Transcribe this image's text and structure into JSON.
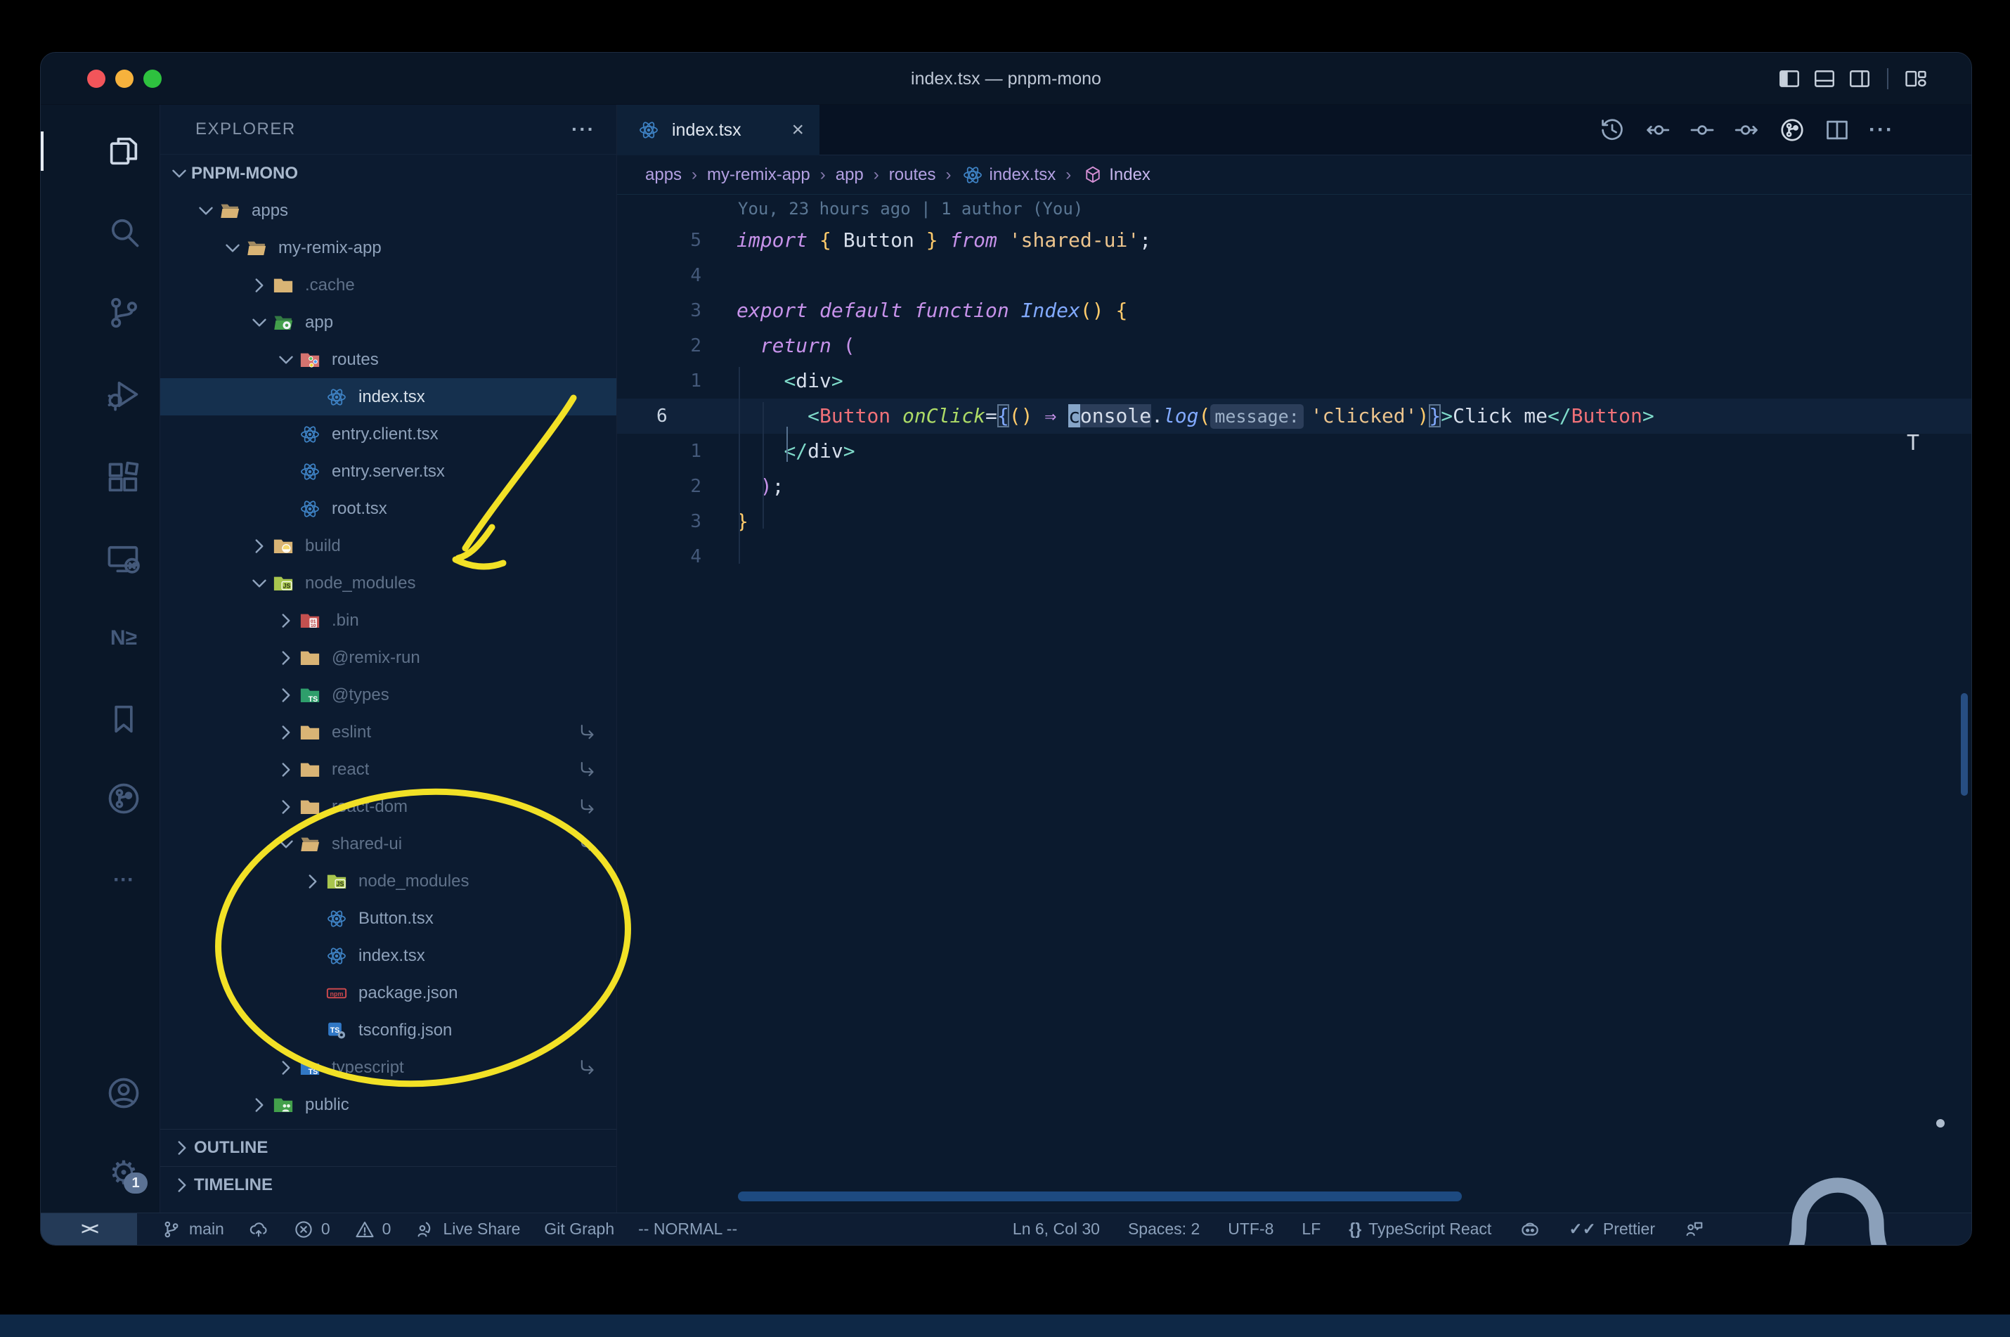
{
  "window": {
    "title": "index.tsx — pnpm-mono",
    "traffic_lights": [
      {
        "name": "close",
        "color": "#f2555a"
      },
      {
        "name": "minimize",
        "color": "#f6b23d"
      },
      {
        "name": "zoom",
        "color": "#2ec13f"
      }
    ],
    "layout_icons": [
      "toggle-sidebar",
      "toggle-panel",
      "toggle-secondary-sidebar",
      "customize-layout"
    ]
  },
  "activity_bar": {
    "items": [
      {
        "name": "explorer",
        "icon": "files",
        "active": true
      },
      {
        "name": "search",
        "icon": "search"
      },
      {
        "name": "source-control",
        "icon": "branch-big"
      },
      {
        "name": "run-debug",
        "icon": "debug"
      },
      {
        "name": "extensions",
        "icon": "extensions"
      },
      {
        "name": "remote-explorer",
        "icon": "remote-win"
      },
      {
        "name": "nx-console",
        "icon": "nx",
        "text": "N≥"
      },
      {
        "name": "bookmarks",
        "icon": "bookmark"
      },
      {
        "name": "git-graph",
        "icon": "git-circle"
      },
      {
        "name": "more-views",
        "icon": "dots",
        "text": "···"
      },
      {
        "name": "account",
        "icon": "account"
      },
      {
        "name": "settings",
        "icon": "gear",
        "text": "⚙",
        "badge": "1"
      }
    ]
  },
  "sidebar": {
    "header": {
      "title": "EXPLORER",
      "more_label": "···"
    },
    "tree": [
      {
        "label": "PNPM-MONO",
        "level": 0,
        "chev": "down",
        "bold": true
      },
      {
        "label": "apps",
        "icon": "folder-open",
        "level": 1,
        "chev": "down"
      },
      {
        "label": "my-remix-app",
        "icon": "folder-open",
        "level": 2,
        "chev": "down"
      },
      {
        "label": ".cache",
        "icon": "folder",
        "level": 3,
        "chev": "right",
        "dim": true
      },
      {
        "label": "app",
        "icon": "folder-app",
        "level": 3,
        "chev": "down"
      },
      {
        "label": "routes",
        "icon": "folder-routes",
        "level": 4,
        "chev": "down"
      },
      {
        "label": "index.tsx",
        "icon": "react",
        "level": 5,
        "selected": true
      },
      {
        "label": "entry.client.tsx",
        "icon": "react",
        "level": 4
      },
      {
        "label": "entry.server.tsx",
        "icon": "react",
        "level": 4
      },
      {
        "label": "root.tsx",
        "icon": "react",
        "level": 4
      },
      {
        "label": "build",
        "icon": "folder-build",
        "level": 3,
        "chev": "right",
        "dim": true
      },
      {
        "label": "node_modules",
        "icon": "folder-nm",
        "level": 3,
        "chev": "down",
        "dim": true
      },
      {
        "label": ".bin",
        "icon": "folder-bin",
        "level": 4,
        "chev": "right",
        "dim": true
      },
      {
        "label": "@remix-run",
        "icon": "folder",
        "level": 4,
        "chev": "right",
        "dim": true
      },
      {
        "label": "@types",
        "icon": "folder-ts-green",
        "level": 4,
        "chev": "right",
        "dim": true
      },
      {
        "label": "eslint",
        "icon": "folder",
        "level": 4,
        "chev": "right",
        "dim": true,
        "link": true
      },
      {
        "label": "react",
        "icon": "folder",
        "level": 4,
        "chev": "right",
        "dim": true,
        "link": true
      },
      {
        "label": "react-dom",
        "icon": "folder",
        "level": 4,
        "chev": "right",
        "dim": true,
        "link": true
      },
      {
        "label": "shared-ui",
        "icon": "folder-open",
        "level": 4,
        "chev": "down",
        "dim": true,
        "link": true
      },
      {
        "label": "node_modules",
        "icon": "folder-nm",
        "level": 5,
        "chev": "right",
        "dim": true
      },
      {
        "label": "Button.tsx",
        "icon": "react",
        "level": 5
      },
      {
        "label": "index.tsx",
        "icon": "react",
        "level": 5
      },
      {
        "label": "package.json",
        "icon": "npm",
        "level": 5
      },
      {
        "label": "tsconfig.json",
        "icon": "ts-config",
        "level": 5
      },
      {
        "label": "typescript",
        "icon": "folder-ts-blue",
        "level": 4,
        "chev": "right",
        "dim": true,
        "link": true
      },
      {
        "label": "public",
        "icon": "folder-public",
        "level": 3,
        "chev": "right"
      }
    ],
    "sections": [
      {
        "label": "OUTLINE"
      },
      {
        "label": "TIMELINE"
      }
    ]
  },
  "editor": {
    "tabs": [
      {
        "label": "index.tsx",
        "icon": "react",
        "close": "×",
        "active": true
      }
    ],
    "actions": [
      "history",
      "prev-commit",
      "commit",
      "next-commit",
      "git-circle-sm",
      "split-editor",
      "more"
    ],
    "breadcrumbs": [
      {
        "label": "apps"
      },
      {
        "label": "my-remix-app"
      },
      {
        "label": "app"
      },
      {
        "label": "routes"
      },
      {
        "label": "index.tsx",
        "icon": "react"
      },
      {
        "label": "Index",
        "icon": "symbol-cube",
        "last": true
      }
    ],
    "blame": "You, 23 hours ago | 1 author (You)",
    "overflow_glyph": "T",
    "code_lines": [
      {
        "num": "5",
        "tokens": [
          [
            "kw",
            "import "
          ],
          [
            "brY",
            "{ "
          ],
          [
            "txt",
            "Button "
          ],
          [
            "brY",
            "} "
          ],
          [
            "kw",
            "from "
          ],
          [
            "str",
            "'shared-ui'"
          ],
          [
            "pun",
            ";"
          ]
        ]
      },
      {
        "num": "4",
        "tokens": []
      },
      {
        "num": "3",
        "tokens": [
          [
            "kw",
            "export default function "
          ],
          [
            "fn",
            "Index"
          ],
          [
            "brY",
            "()"
          ],
          [
            "pun",
            " "
          ],
          [
            "brY",
            "{"
          ]
        ]
      },
      {
        "num": "2",
        "tokens": [
          [
            "pun",
            "  "
          ],
          [
            "kw",
            "return "
          ],
          [
            "brP",
            "("
          ]
        ]
      },
      {
        "num": "1",
        "tokens": [
          [
            "pun",
            "    "
          ],
          [
            "tag",
            "<"
          ],
          [
            "txt",
            "div"
          ],
          [
            "tag",
            ">"
          ]
        ]
      },
      {
        "num": "6",
        "active": true,
        "tokens": [
          [
            "pun",
            "      "
          ],
          [
            "tag",
            "<"
          ],
          [
            "cmp",
            "Button"
          ],
          [
            "pun",
            " "
          ],
          [
            "attr",
            "onClick"
          ],
          [
            "pun",
            "="
          ],
          [
            "brB box",
            "{"
          ],
          [
            "brY",
            "()"
          ],
          [
            "pun",
            " "
          ],
          [
            "arrow",
            "⇒"
          ],
          [
            "pun",
            " "
          ],
          [
            "cursor",
            "c"
          ],
          [
            "hl",
            "onsole"
          ],
          [
            "pun",
            "."
          ],
          [
            "fn",
            "log"
          ],
          [
            "brY",
            "("
          ],
          [
            "inlay",
            "message:"
          ],
          [
            "str",
            "'clicked'"
          ],
          [
            "brY",
            ")"
          ],
          [
            "brB box",
            "}"
          ],
          [
            "tag",
            ">"
          ],
          [
            "txt",
            "Click me"
          ],
          [
            "tag",
            "</"
          ],
          [
            "cmp",
            "Button"
          ],
          [
            "tag",
            ">"
          ]
        ]
      },
      {
        "num": "1",
        "tokens": [
          [
            "pun",
            "    "
          ],
          [
            "tag",
            "</"
          ],
          [
            "txt",
            "div"
          ],
          [
            "tag",
            ">"
          ]
        ]
      },
      {
        "num": "2",
        "tokens": [
          [
            "pun",
            "  "
          ],
          [
            "brP",
            ")"
          ],
          [
            "pun",
            ";"
          ]
        ]
      },
      {
        "num": "3",
        "tokens": [
          [
            "brY",
            "}"
          ]
        ]
      },
      {
        "num": "4",
        "tokens": []
      }
    ]
  },
  "status_bar": {
    "remote": {
      "label": "><"
    },
    "left": [
      {
        "name": "branch",
        "icon": "branch",
        "label": "main"
      },
      {
        "name": "sync",
        "icon": "cloud-up",
        "label": ""
      },
      {
        "name": "errors",
        "icon": "error",
        "label": "0"
      },
      {
        "name": "warnings",
        "icon": "warning",
        "label": "0"
      },
      {
        "name": "live-share",
        "icon": "live-share",
        "label": "Live Share"
      },
      {
        "name": "git-graph",
        "label": "Git Graph"
      },
      {
        "name": "vim-mode",
        "label": "-- NORMAL --"
      }
    ],
    "right": [
      {
        "name": "cursor-position",
        "label": "Ln 6, Col 30"
      },
      {
        "name": "indentation",
        "label": "Spaces: 2"
      },
      {
        "name": "encoding",
        "label": "UTF-8"
      },
      {
        "name": "eol",
        "label": "LF"
      },
      {
        "name": "language-mode",
        "text_icon": "{}",
        "label": "TypeScript React"
      },
      {
        "name": "copilot",
        "icon": "copilot",
        "label": ""
      },
      {
        "name": "prettier",
        "text_icon": "✓✓",
        "label": "Prettier"
      },
      {
        "name": "feedback",
        "icon": "feedback",
        "label": ""
      },
      {
        "name": "notifications",
        "icon": "bell",
        "label": "",
        "dot": true
      }
    ]
  },
  "annotations": {
    "color": "#f2e126",
    "items": [
      "arrow-to-node-modules",
      "circle-around-shared-ui"
    ]
  }
}
